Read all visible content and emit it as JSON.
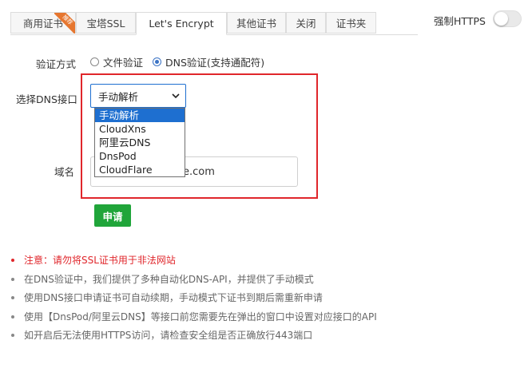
{
  "tabs": [
    {
      "label": "商用证书",
      "badge": "推荐",
      "active": false
    },
    {
      "label": "宝塔SSL",
      "active": false
    },
    {
      "label": "Let's Encrypt",
      "active": true
    },
    {
      "label": "其他证书",
      "active": false
    },
    {
      "label": "关闭",
      "active": false
    },
    {
      "label": "证书夹",
      "active": false
    }
  ],
  "force_https": {
    "label": "强制HTTPS",
    "enabled": false
  },
  "form": {
    "verify_label": "验证方式",
    "verify_options": [
      {
        "label": "文件验证",
        "checked": false
      },
      {
        "label": "DNS验证(支持通配符)",
        "checked": true
      }
    ],
    "dns_label": "选择DNS接口",
    "dns_selected": "手动解析",
    "dns_options": [
      "手动解析",
      "CloudXns",
      "阿里云DNS",
      "DnsPod",
      "CloudFlare"
    ],
    "domain_label": "域名",
    "domain_value_visible": "e.com",
    "apply_label": "申请"
  },
  "notes": [
    {
      "text": "注意：请勿将SSL证书用于非法网站",
      "warning": true
    },
    {
      "text": "在DNS验证中，我们提供了多种自动化DNS-API，并提供了手动模式",
      "warning": false
    },
    {
      "text": "使用DNS接口申请证书可自动续期，手动模式下证书到期后需重新申请",
      "warning": false
    },
    {
      "text": "使用【DnsPod/阿里云DNS】等接口前您需要先在弹出的窗口中设置对应接口的API",
      "warning": false
    },
    {
      "text": "如开启后无法使用HTTPS访问，请检查安全组是否正确放行443端口",
      "warning": false
    }
  ],
  "colors": {
    "accent": "#20a53a",
    "highlight": "#e0262b",
    "select_blue": "#1e6fd0",
    "badge": "#e6762f"
  }
}
